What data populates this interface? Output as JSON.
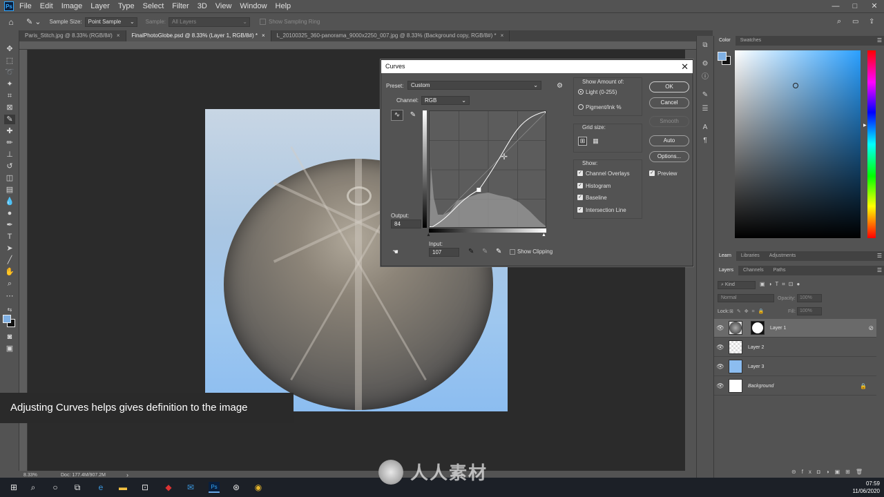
{
  "menu": {
    "logo": "Ps",
    "items": [
      "File",
      "Edit",
      "Image",
      "Layer",
      "Type",
      "Select",
      "Filter",
      "3D",
      "View",
      "Window",
      "Help"
    ],
    "window_controls": [
      "—",
      "□",
      "✕"
    ]
  },
  "options": {
    "sample_size_label": "Sample Size:",
    "sample_size_value": "Point Sample",
    "sample_label": "Sample:",
    "sample_value": "All Layers",
    "sampling_ring_label": "Show Sampling Ring"
  },
  "tabs": [
    {
      "label": "Paris_Stitch.jpg @ 8.33% (RGB/8#)",
      "active": false
    },
    {
      "label": "FinalPhotoGlobe.psd @ 8.33% (Layer 1, RGB/8#) *",
      "active": true
    },
    {
      "label": "L_20100325_360-panorama_9000x2250_007.jpg @ 8.33% (Background copy, RGB/8#) *",
      "active": false
    }
  ],
  "caption": "Adjusting Curves helps gives definition to the image",
  "status": {
    "zoom": "8.33%",
    "doc": "Doc: 177.4M/907.2M",
    "arrow": "›"
  },
  "curves": {
    "title": "Curves",
    "close": "✕",
    "preset_label": "Preset:",
    "preset_value": "Custom",
    "channel_label": "Channel:",
    "channel_value": "RGB",
    "output_label": "Output:",
    "output_value": "84",
    "input_label": "Input:",
    "input_value": "107",
    "show_clipping": "Show Clipping",
    "show_amount_label": "Show Amount of:",
    "light_option": "Light  (0-255)",
    "pigment_option": "Pigment/Ink %",
    "grid_size_label": "Grid size:",
    "show_label": "Show:",
    "show_options": [
      "Channel Overlays",
      "Histogram",
      "Baseline",
      "Intersection Line"
    ],
    "buttons": {
      "ok": "OK",
      "cancel": "Cancel",
      "smooth": "Smooth",
      "auto": "Auto",
      "options": "Options..."
    },
    "preview_label": "Preview",
    "curve_points": [
      [
        0,
        0
      ],
      [
        107,
        84
      ],
      [
        255,
        255
      ]
    ]
  },
  "color_panel": {
    "tabs": [
      "Color",
      "Swatches"
    ],
    "foreground": "#7fb0e4",
    "background": "#111111"
  },
  "learn_tabs": [
    "Learn",
    "Libraries",
    "Adjustments"
  ],
  "layers_panel": {
    "tabs": [
      "Layers",
      "Channels",
      "Paths"
    ],
    "filter_label": "Kind",
    "blend_mode": "Normal",
    "opacity_label": "Opacity:",
    "opacity_value": "100%",
    "lock_label": "Lock:",
    "fill_label": "Fill:",
    "fill_value": "100%",
    "layers": [
      {
        "name": "Layer 1",
        "selected": true
      },
      {
        "name": "Layer 2",
        "selected": false
      },
      {
        "name": "Layer 3",
        "selected": false
      },
      {
        "name": "Background",
        "selected": false
      }
    ]
  },
  "taskbar": {
    "time": "07:59",
    "date": "11/06/2020"
  },
  "watermark": "人人素材"
}
